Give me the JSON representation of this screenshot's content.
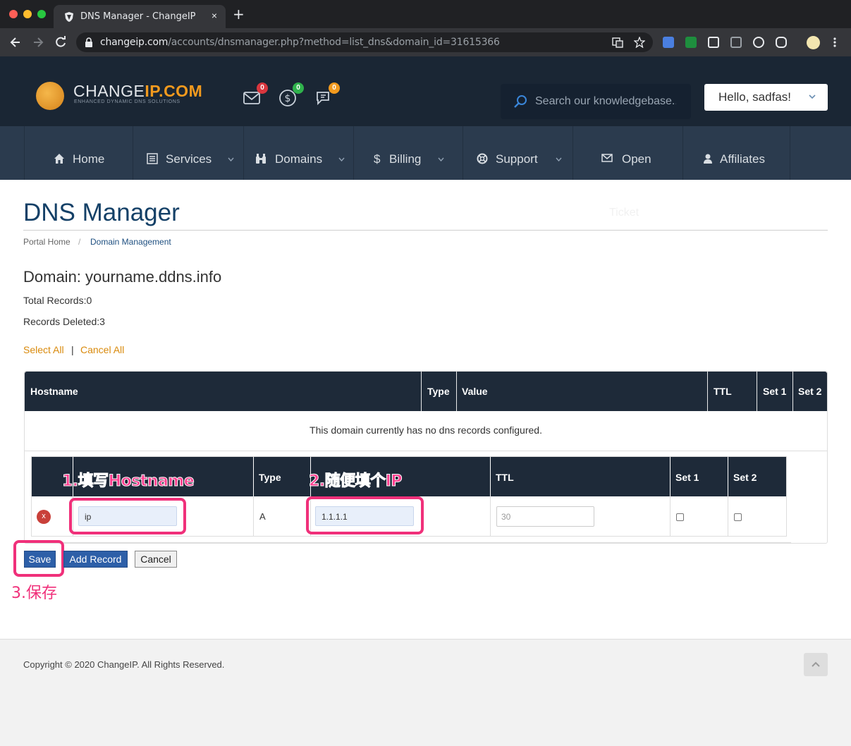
{
  "browser": {
    "tab_title": "DNS Manager - ChangeIP",
    "tab_close": "×",
    "new_tab": "+",
    "url_host": "changeip.com",
    "url_path": "/accounts/dnsmanager.php?method=list_dns&domain_id=31615366",
    "colors": {
      "close": "#ff5f57",
      "minimize": "#febc2e",
      "zoom": "#28c840"
    }
  },
  "header": {
    "logo_main": "CHANGE",
    "logo_ip": "IP.COM",
    "logo_tagline": "ENHANCED DYNAMIC DNS SOLUTIONS",
    "icons": [
      {
        "name": "envelope-icon",
        "badge": "0",
        "badge_color": "#d9363e"
      },
      {
        "name": "dollar-icon",
        "badge": "0",
        "badge_color": "#2fb24c"
      },
      {
        "name": "chat-icon",
        "badge": "0",
        "badge_color": "#f29a1e"
      }
    ],
    "search_placeholder": "Search our knowledgebase...",
    "hello": "Hello, sadfas!"
  },
  "nav": {
    "items": [
      {
        "label": "Home",
        "icon": "home-icon",
        "dropdown": false
      },
      {
        "label": "Services",
        "icon": "list-icon",
        "dropdown": true
      },
      {
        "label": "Domains",
        "icon": "binoculars-icon",
        "dropdown": true
      },
      {
        "label": "Billing",
        "icon": "dollar-icon",
        "dropdown": true
      },
      {
        "label": "Support",
        "icon": "lifebuoy-icon",
        "dropdown": true
      },
      {
        "label": "Open",
        "icon": "envelope-icon",
        "dropdown": false
      },
      {
        "label": "Affiliates",
        "icon": "user-icon",
        "dropdown": false
      }
    ],
    "ghost_label": "Ticket"
  },
  "page": {
    "title": "DNS Manager",
    "breadcrumb_home": "Portal Home",
    "breadcrumb_sep": "/",
    "breadcrumb_current": "Domain Management",
    "domain_heading": "Domain: yourname.ddns.info",
    "total_records": "Total Records:0",
    "records_deleted": "Records Deleted:3",
    "select_all": "Select All",
    "separator": "|",
    "cancel_all": "Cancel All"
  },
  "records_table": {
    "columns": [
      "Hostname",
      "Type",
      "Value",
      "TTL",
      "Set 1",
      "Set 2"
    ],
    "empty_message": "This domain currently has no dns records configured."
  },
  "new_record": {
    "columns": [
      "",
      "Type",
      "",
      "TTL",
      "Set 1",
      "Set 2"
    ],
    "delete_label": "x",
    "hostname_value": "ip",
    "type_value": "A",
    "ip_value": "1.1.1.1",
    "ttl_placeholder": "30"
  },
  "annotations": {
    "hostname": "1.填写Hostname",
    "ip": "2.随便填个IP",
    "save": "3.保存",
    "color": "#f0307a"
  },
  "buttons": {
    "save": "Save",
    "add_record": "Add Record",
    "cancel": "Cancel"
  },
  "footer": {
    "copyright": "Copyright © 2020 ChangeIP. All Rights Reserved."
  }
}
